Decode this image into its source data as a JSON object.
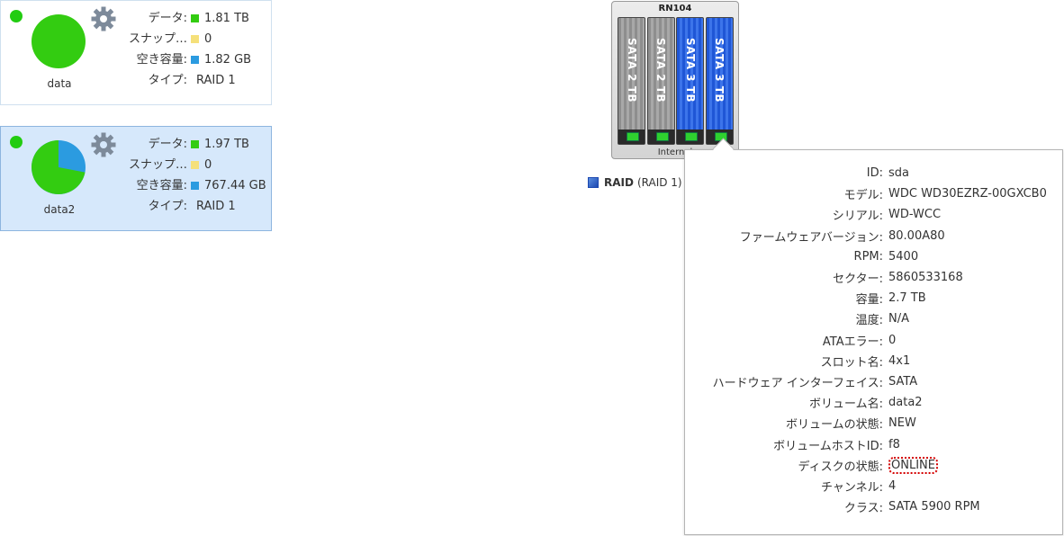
{
  "volumes": [
    {
      "name": "data",
      "selected": false,
      "stats": [
        {
          "label": "データ:",
          "value": "1.81 TB",
          "color": "#33cc11"
        },
        {
          "label": "スナップ…",
          "value": "0",
          "color": "#f5e07a"
        },
        {
          "label": "空き容量:",
          "value": "1.82 GB",
          "color": "#2b9be0"
        },
        {
          "label": "タイプ:",
          "value": "RAID 1",
          "color": ""
        }
      ],
      "usage_fraction": 0.999
    },
    {
      "name": "data2",
      "selected": true,
      "stats": [
        {
          "label": "データ:",
          "value": "1.97 TB",
          "color": "#33cc11"
        },
        {
          "label": "スナップ…",
          "value": "0",
          "color": "#f5e07a"
        },
        {
          "label": "空き容量:",
          "value": "767.44 GB",
          "color": "#2b9be0"
        },
        {
          "label": "タイプ:",
          "value": "RAID 1",
          "color": ""
        }
      ],
      "usage_fraction": 0.72
    }
  ],
  "chassis": {
    "model": "RN104",
    "footer": "Internal",
    "bays": [
      {
        "label": "SATA 2 TB",
        "color": "gray"
      },
      {
        "label": "SATA 2 TB",
        "color": "gray"
      },
      {
        "label": "SATA 3 TB",
        "color": "blue"
      },
      {
        "label": "SATA 3 TB",
        "color": "blue"
      }
    ]
  },
  "raid_legend": {
    "name": "RAID",
    "type": "(RAID 1)"
  },
  "disk_info": [
    {
      "key": "ID:",
      "value": "sda"
    },
    {
      "key": "モデル:",
      "value": "WDC WD30EZRZ-00GXCB0"
    },
    {
      "key": "シリアル:",
      "value": "WD-WCC"
    },
    {
      "key": "ファームウェアバージョン:",
      "value": "80.00A80"
    },
    {
      "key": "RPM:",
      "value": "5400"
    },
    {
      "key": "セクター:",
      "value": "5860533168"
    },
    {
      "key": "容量:",
      "value": "2.7 TB"
    },
    {
      "key": "温度:",
      "value": "N/A"
    },
    {
      "key": "ATAエラー:",
      "value": "0"
    },
    {
      "key": "スロット名:",
      "value": "4x1"
    },
    {
      "key": "ハードウェア インターフェイス:",
      "value": "SATA"
    },
    {
      "key": "ボリューム名:",
      "value": "data2"
    },
    {
      "key": "ボリュームの状態:",
      "value": "NEW"
    },
    {
      "key": "ボリュームホストID:",
      "value": "f8"
    },
    {
      "key": "ディスクの状態:",
      "value": "ONLINE"
    },
    {
      "key": "チャンネル:",
      "value": "4"
    },
    {
      "key": "クラス:",
      "value": "SATA 5900 RPM"
    }
  ],
  "colors": {
    "data": "#33cc11",
    "free": "#2b9be0",
    "status_ok": "#22cc11"
  }
}
